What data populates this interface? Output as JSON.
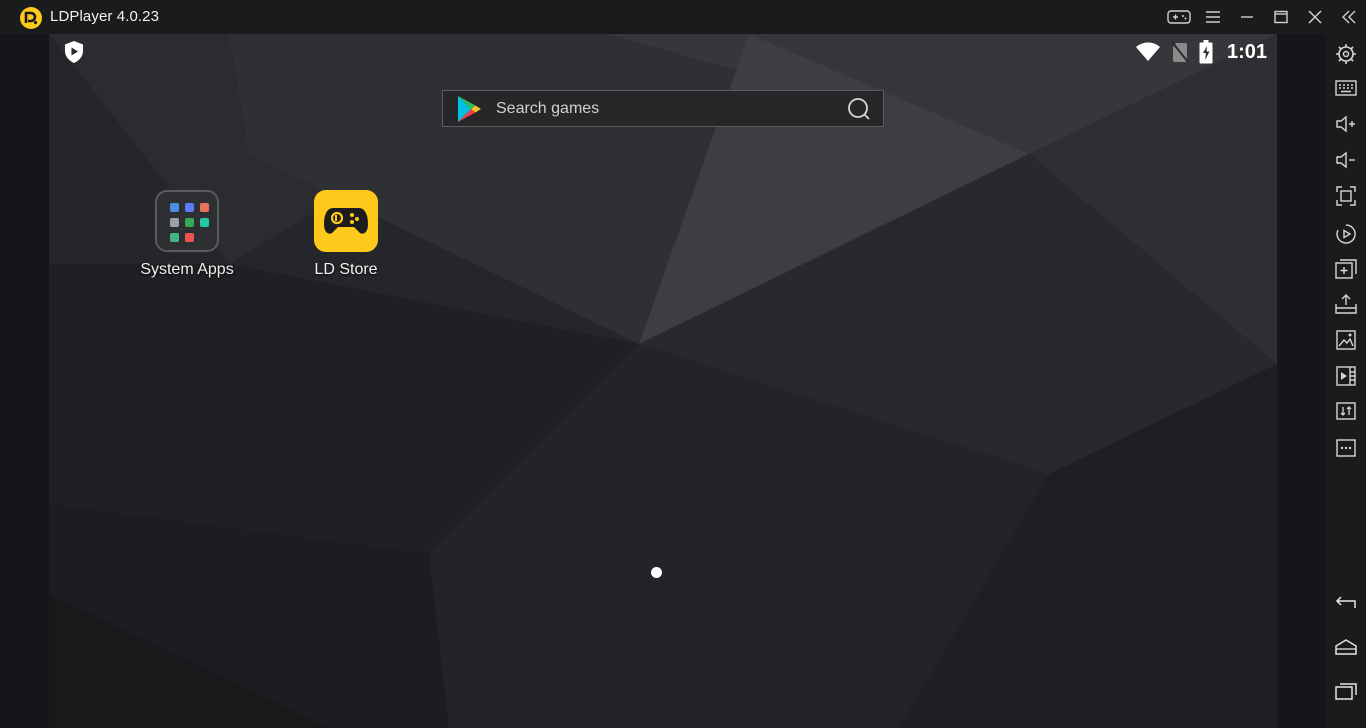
{
  "window": {
    "title": "LDPlayer 4.0.23"
  },
  "status_bar": {
    "time": "1:01"
  },
  "search": {
    "placeholder": "Search games"
  },
  "desktop": {
    "apps": [
      {
        "label": "System Apps"
      },
      {
        "label": "LD Store"
      }
    ]
  },
  "colors": {
    "accent_yellow": "#fdc91b",
    "titlebar_bg": "#1a1b1d",
    "sidebar_bg": "#1a1b1d",
    "screen_bg": "#222326"
  },
  "icons": {
    "titlebar": [
      "ldplayer-logo-icon",
      "gamepad-icon",
      "menu-icon",
      "minimize-icon",
      "maximize-icon",
      "close-icon",
      "collapse-sidebar-icon"
    ],
    "sidebar": [
      "settings-icon",
      "keyboard-icon",
      "volume-up-icon",
      "volume-down-icon",
      "fullscreen-icon",
      "record-icon",
      "add-apk-icon",
      "install-icon",
      "screenshot-icon",
      "video-icon",
      "sync-icon",
      "more-icon",
      "back-icon",
      "home-icon",
      "recents-icon"
    ]
  }
}
